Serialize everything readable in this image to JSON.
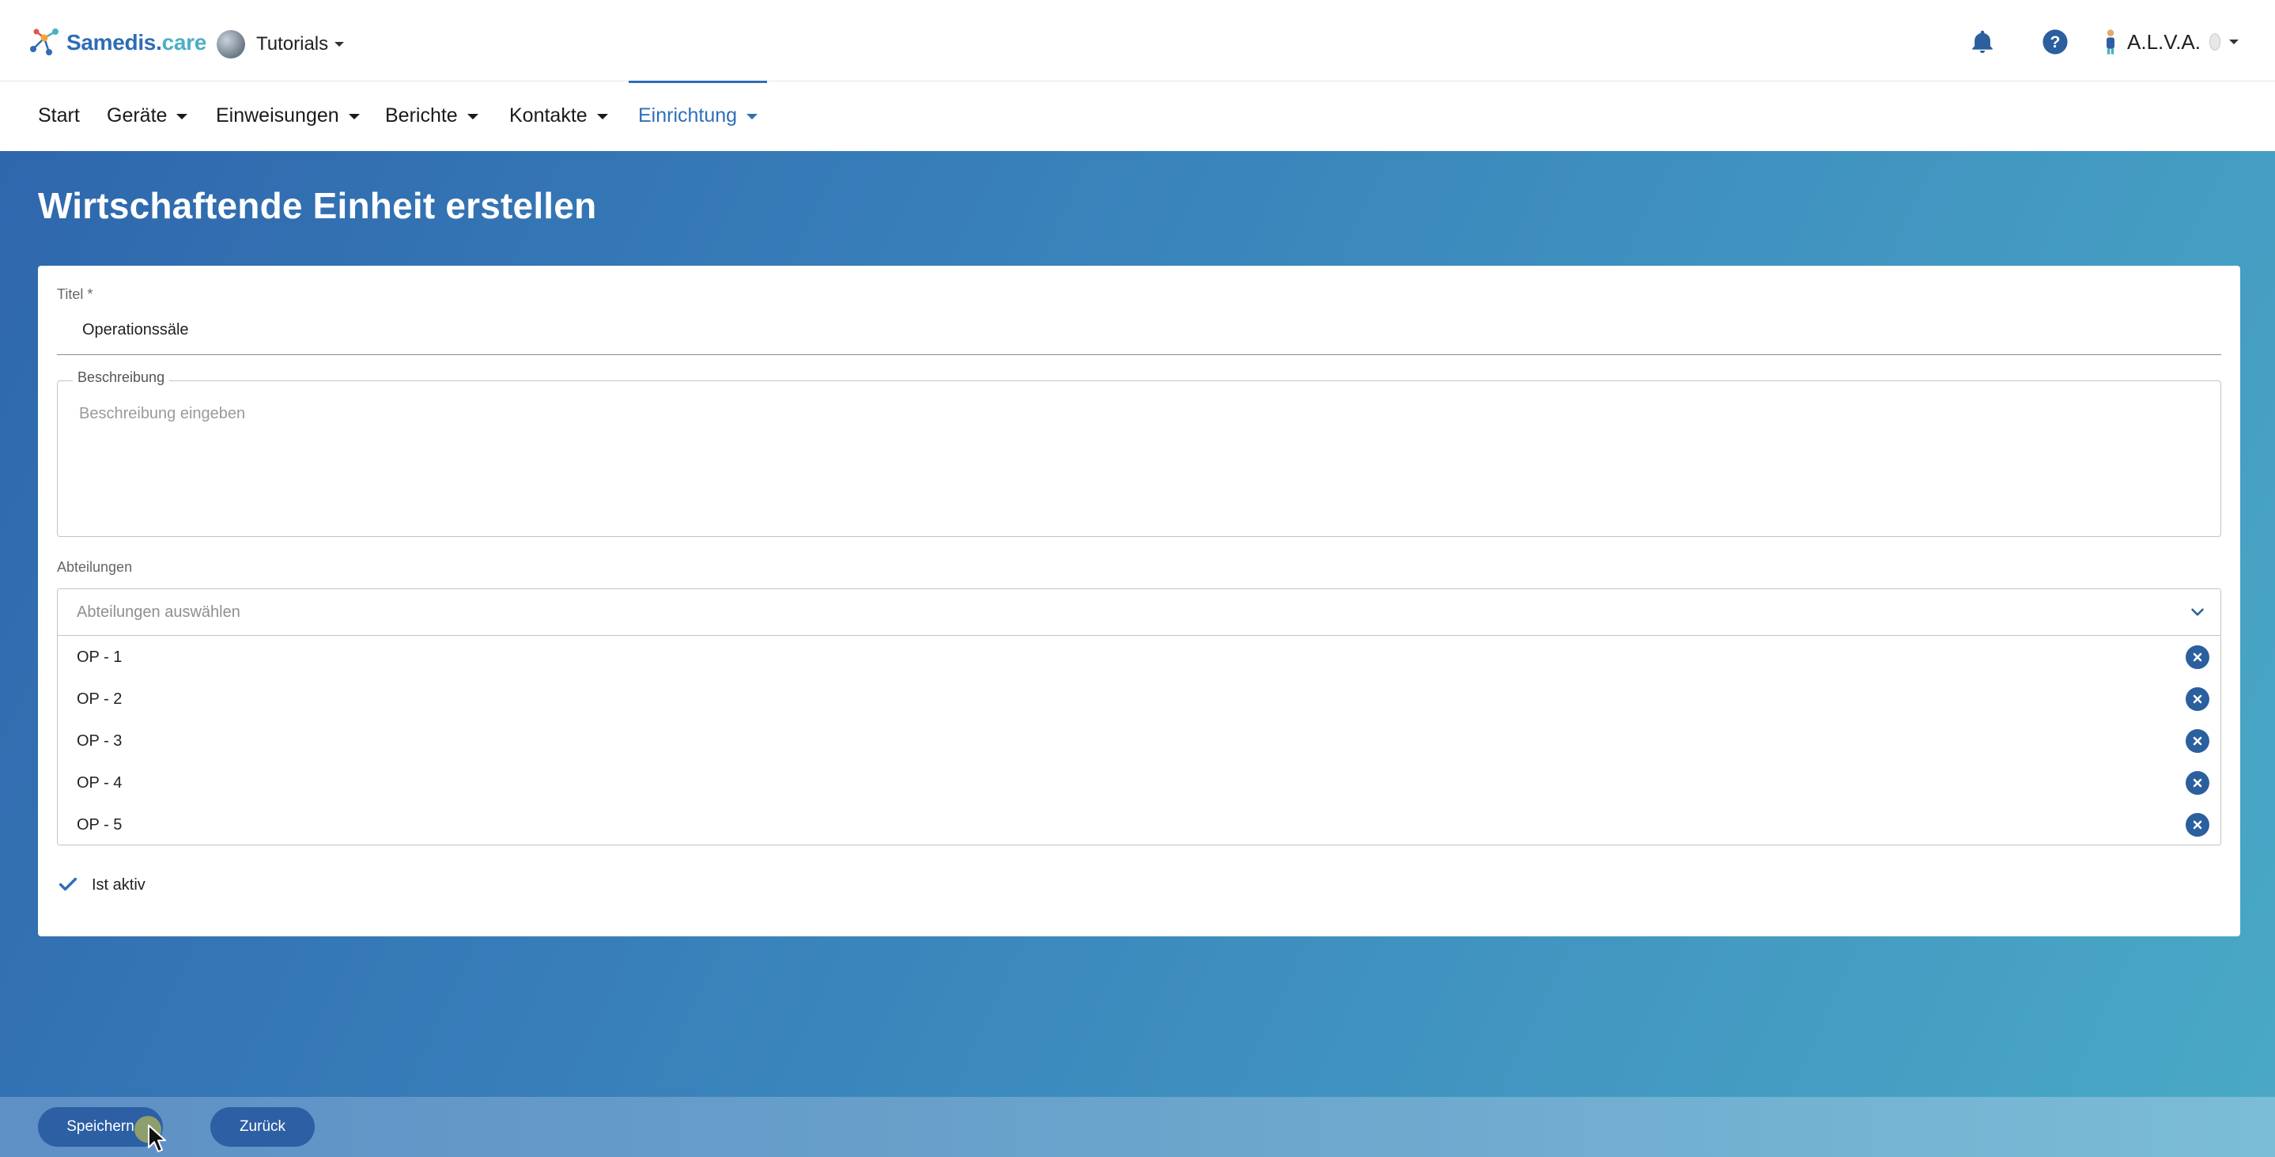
{
  "header": {
    "logo_main": "Samedis.",
    "logo_suffix": "care",
    "tenant": "Tutorials",
    "user": "A.L.V.A."
  },
  "nav": {
    "items": [
      {
        "label": "Start"
      },
      {
        "label": "Geräte"
      },
      {
        "label": "Einweisungen"
      },
      {
        "label": "Berichte"
      },
      {
        "label": "Kontakte"
      },
      {
        "label": "Einrichtung"
      }
    ],
    "active": "Einrichtung"
  },
  "page": {
    "title": "Wirtschaftende Einheit erstellen"
  },
  "form": {
    "title_label": "Titel *",
    "title_value": "Operationssäle",
    "description_label": "Beschreibung",
    "description_placeholder": "Beschreibung eingeben",
    "departments_label": "Abteilungen",
    "departments_placeholder": "Abteilungen auswählen",
    "departments": [
      "OP - 1",
      "OP - 2",
      "OP - 3",
      "OP - 4",
      "OP - 5"
    ],
    "active_label": "Ist aktiv",
    "active_checked": true
  },
  "footer": {
    "save_label": "Speichern",
    "back_label": "Zurück"
  },
  "colors": {
    "brand": "#2e6db4",
    "accent": "#4bb0c4",
    "button": "#2c5fa3"
  }
}
